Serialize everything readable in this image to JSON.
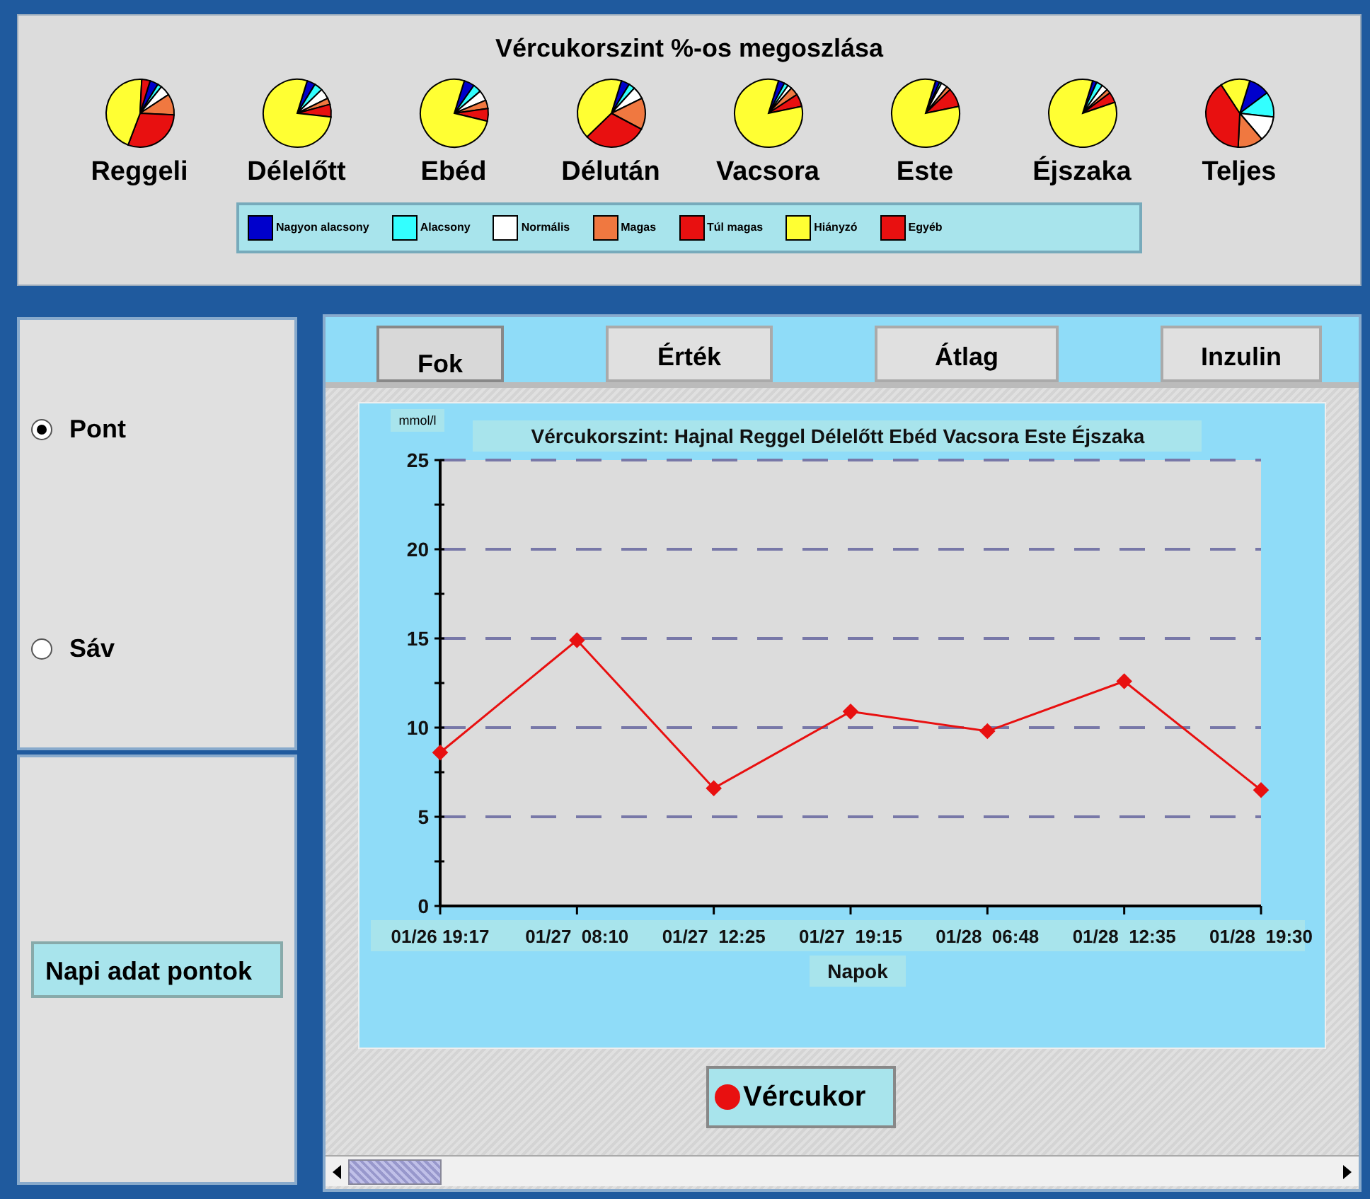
{
  "distribution": {
    "title": "Vércukorszint %-os megoszlása",
    "pies": [
      {
        "label": "Reggeli"
      },
      {
        "label": "Délelőtt"
      },
      {
        "label": "Ebéd"
      },
      {
        "label": "Délután"
      },
      {
        "label": "Vacsora"
      },
      {
        "label": "Este"
      },
      {
        "label": "Éjszaka"
      },
      {
        "label": "Teljes"
      }
    ],
    "legend": [
      {
        "label": "Nagyon alacsony",
        "color": "#0000cc"
      },
      {
        "label": "Alacsony",
        "color": "#33ffff"
      },
      {
        "label": "Normális",
        "color": "#ffffff"
      },
      {
        "label": "Magas",
        "color": "#f07840"
      },
      {
        "label": "Túl magas",
        "color": "#e81010"
      },
      {
        "label": "Hiányzó",
        "color": "#ffff33"
      },
      {
        "label": "Egyéb",
        "color": "#e81010"
      }
    ]
  },
  "display_mode": [
    {
      "label": "Pont",
      "selected": true
    },
    {
      "label": "Sáv",
      "selected": false
    }
  ],
  "daily_points_label": "Napi adat pontok",
  "tabs": [
    {
      "label": "Fok",
      "selected": true
    },
    {
      "label": "Érték",
      "selected": false
    },
    {
      "label": "Átlag",
      "selected": false
    },
    {
      "label": "Inzulin",
      "selected": false
    }
  ],
  "chart": {
    "title": "Vércukorszint: Hajnal Reggel Délelőtt Ebéd Vacsora Este Éjszaka",
    "chart_data": {
      "type": "line",
      "xlabel": "Napok",
      "ylabel": "mmol/l",
      "categories": [
        "01/26 19:17",
        "01/27  08:10",
        "01/27  12:25",
        "01/27  19:15",
        "01/28  06:48",
        "01/28  12:35",
        "01/28  19:30"
      ],
      "grid": true,
      "series": [
        {
          "name": "Vércukor",
          "color": "#e81010",
          "marker": "diamond",
          "values": [
            8.6,
            14.9,
            6.6,
            10.9,
            9.8,
            12.6,
            6.5
          ]
        }
      ],
      "ylim": [
        0,
        25
      ],
      "yticks": [
        0,
        5,
        10,
        15,
        20,
        25
      ]
    }
  }
}
